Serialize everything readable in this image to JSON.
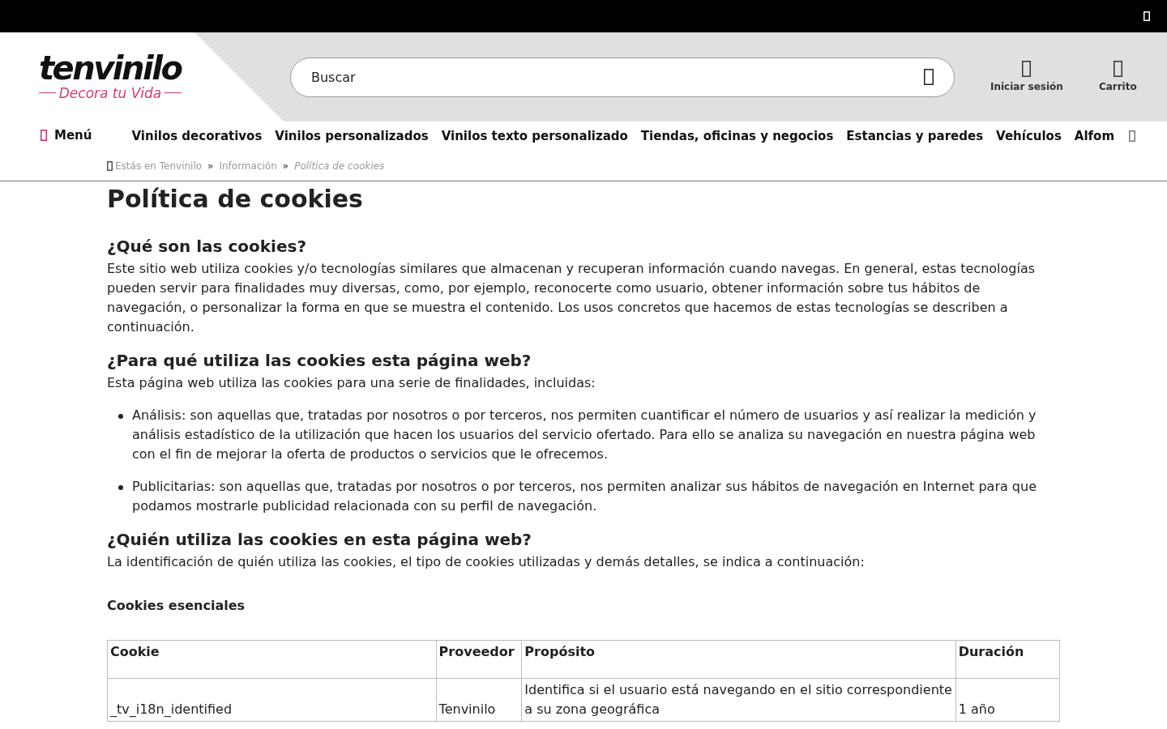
{
  "header": {
    "logo": {
      "wordmark": "tenvinilo",
      "tagline": "Decora tu Vida"
    },
    "search": {
      "placeholder": "Buscar"
    },
    "actions": [
      {
        "label": "Iniciar sesión"
      },
      {
        "label": "Carrito"
      }
    ]
  },
  "nav": {
    "menu_label": "Menú",
    "items": [
      "Vinilos decorativos",
      "Vinilos personalizados",
      "Vinilos texto personalizado",
      "Tiendas, oficinas y negocios",
      "Estancias y paredes",
      "Vehículos",
      "Alfom"
    ]
  },
  "breadcrumb": [
    {
      "kind": "link",
      "label": "Estás en Tenvinilo"
    },
    {
      "kind": "separator",
      "label": "»"
    },
    {
      "kind": "link",
      "label": "Información"
    },
    {
      "kind": "separator",
      "label": "»"
    },
    {
      "kind": "current",
      "label": "Política de cookies"
    }
  ],
  "content": {
    "title": "Política de cookies",
    "sections": [
      {
        "heading": "¿Qué son las cookies?",
        "paragraph": "Este sitio web utiliza cookies y/o tecnologías similares que almacenan y recuperan información cuando navegas. En general, estas tecnologías pueden servir para finalidades muy diversas, como, por ejemplo, reconocerte como usuario, obtener información sobre tus hábitos de navegación, o personalizar la forma en que se muestra el contenido. Los usos concretos que hacemos de estas tecnologías se describen a continuación."
      },
      {
        "heading": "¿Para qué utiliza las cookies esta página web?",
        "paragraph": "Esta página web utiliza las cookies para una serie de finalidades, incluidas:",
        "bullets": [
          "Análisis: son aquellas que, tratadas por nosotros o por terceros, nos permiten cuantificar el número de usuarios y así realizar la medición y análisis estadístico de la utilización que hacen los usuarios del servicio ofertado. Para ello se analiza su navegación en nuestra página web con el fin de mejorar la oferta de productos o servicios que le ofrecemos.",
          "Publicitarias: son aquellas que, tratadas por nosotros o por terceros, nos permiten analizar sus hábitos de navegación en Internet para que podamos mostrarle publicidad relacionada con su perfil de navegación."
        ]
      },
      {
        "heading": "¿Quién utiliza las cookies en esta página web?",
        "paragraph": "La identificación de quién utiliza las cookies, el tipo de cookies utilizadas y demás detalles, se indica a continuación:"
      }
    ],
    "cookie_table": {
      "title": "Cookies esenciales",
      "columns": [
        "Cookie",
        "Proveedor",
        "Propósito",
        "Duración"
      ],
      "rows": [
        [
          "_tv_i18n_identified",
          "Tenvinilo",
          "Identifica si el usuario está navegando en el sitio correspondiente a su zona geográfica",
          "1 año"
        ]
      ]
    }
  }
}
